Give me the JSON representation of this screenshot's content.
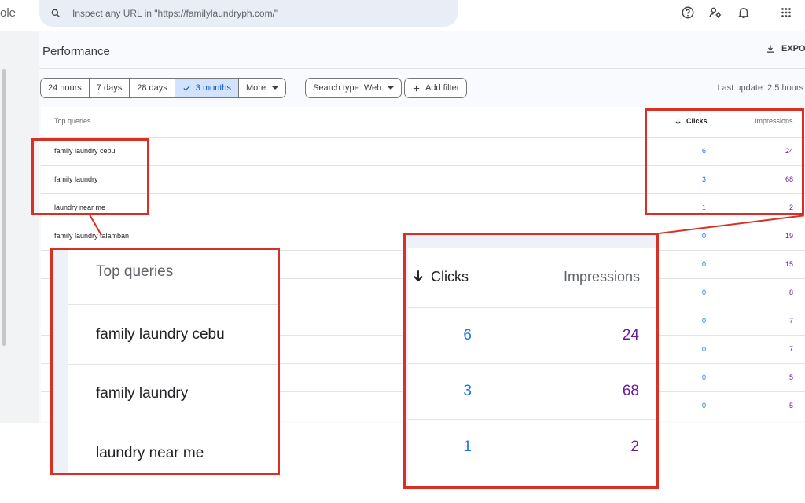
{
  "app": {
    "name_fragment": "ole"
  },
  "search": {
    "placeholder": "Inspect any URL in \"https://familylaundryph.com/\""
  },
  "icons": [
    "search-icon",
    "help-icon",
    "admin-icon",
    "bell-icon",
    "apps-grid-icon",
    "download-icon",
    "arrow-down-icon",
    "check-icon",
    "plus-icon"
  ],
  "page": {
    "title": "Performance",
    "export_label": "EXPO",
    "last_update": "Last update: 2.5 hours"
  },
  "filters": {
    "date_ranges": [
      "24 hours",
      "7 days",
      "28 days",
      "3 months"
    ],
    "selected": "3 months",
    "more_label": "More",
    "search_type": "Search type: Web",
    "add_filter": "Add filter"
  },
  "table": {
    "headers": {
      "queries": "Top queries",
      "clicks": "Clicks",
      "impressions": "Impressions"
    },
    "rows": [
      {
        "query": "family laundry cebu",
        "clicks": "6",
        "impressions": "24"
      },
      {
        "query": "family laundry",
        "clicks": "3",
        "impressions": "68"
      },
      {
        "query": "laundry near me",
        "clicks": "1",
        "impressions": "2"
      },
      {
        "query": "family laundry talamban",
        "clicks": "0",
        "impressions": "19"
      },
      {
        "query": "",
        "clicks": "0",
        "impressions": "15"
      },
      {
        "query": "",
        "clicks": "0",
        "impressions": "8"
      },
      {
        "query": "",
        "clicks": "0",
        "impressions": "7"
      },
      {
        "query": "",
        "clicks": "0",
        "impressions": "7"
      },
      {
        "query": "",
        "clicks": "0",
        "impressions": "5"
      },
      {
        "query": "",
        "clicks": "0",
        "impressions": "5"
      }
    ]
  },
  "colors": {
    "clicks": "#1a73e8",
    "impressions": "#6a1b9a",
    "highlight": "#d93025",
    "selected_bg": "#d3e3fd"
  }
}
